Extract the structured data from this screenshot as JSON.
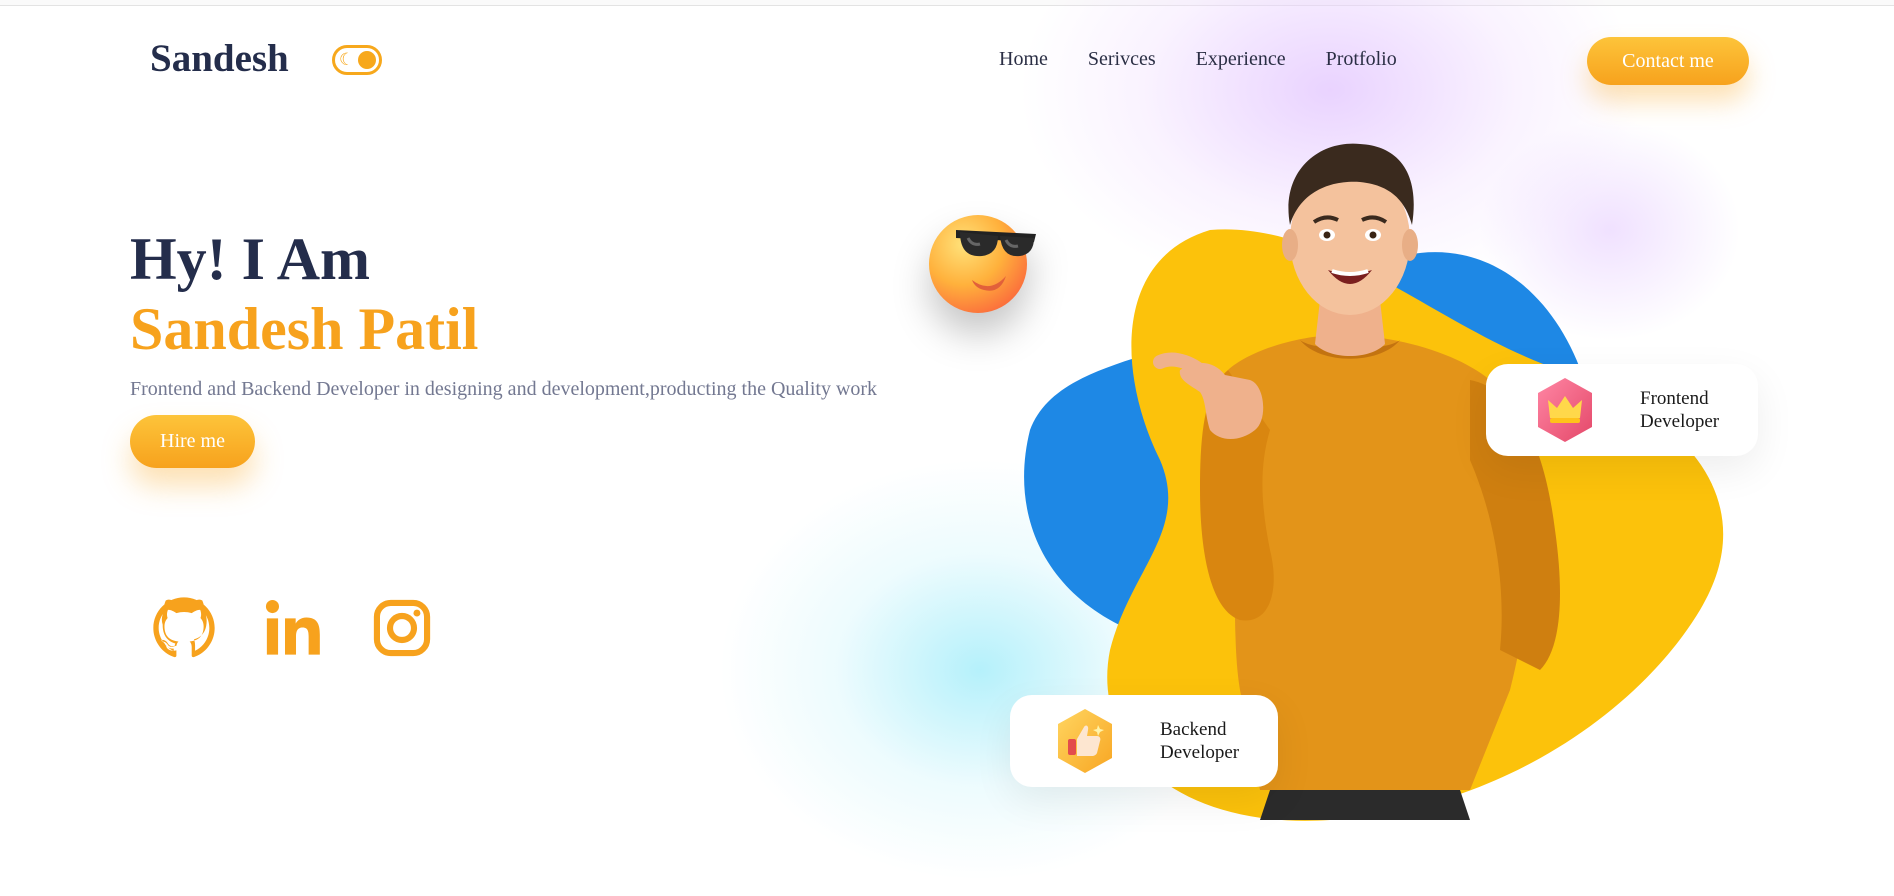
{
  "brand": {
    "name": "Sandesh"
  },
  "theme_toggle": {
    "icon": "moon-icon"
  },
  "nav": {
    "items": [
      "Home",
      "Serivces",
      "Experience",
      "Protfolio"
    ]
  },
  "contact_button": {
    "label": "Contact me"
  },
  "hero": {
    "greeting": "Hy! I Am",
    "name": "Sandesh Patil",
    "description": "Frontend and Backend Developer in designing and development,producting the Quality work",
    "hire_label": "Hire me"
  },
  "social": [
    {
      "icon": "github-icon"
    },
    {
      "icon": "linkedin-icon"
    },
    {
      "icon": "instagram-icon"
    }
  ],
  "cards": {
    "frontend": {
      "line1": "Frontend",
      "line2": "Developer",
      "icon": "crown-icon"
    },
    "backend": {
      "line1": "Backend",
      "line2": "Developer",
      "icon": "thumbs-up-icon"
    }
  },
  "colors": {
    "accent": "#f7a21d",
    "heading": "#242d4b",
    "muted": "#737891",
    "blob_yellow": "#fcc20b",
    "blob_blue": "#1e88e5",
    "sweater": "#e39419"
  }
}
